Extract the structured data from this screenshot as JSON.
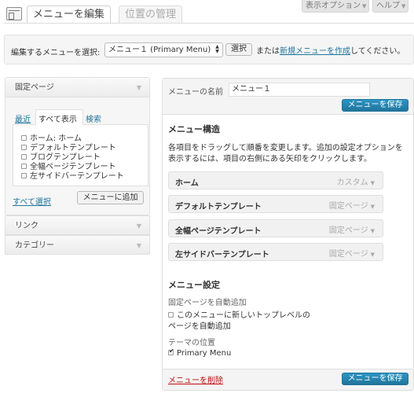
{
  "top_buttons": {
    "screen_options": "表示オプション",
    "help": "ヘルプ"
  },
  "header": {
    "active_tab": "メニューを編集",
    "inactive_tab": "位置の管理"
  },
  "select_bar": {
    "label": "編集するメニューを選択:",
    "selected_menu": "メニュー１ (Primary Menu)",
    "select_button": "選択",
    "or_text": "または",
    "create_link": "新規メニューを作成",
    "suffix": "してください。"
  },
  "sidebar": {
    "pages_title": "固定ページ",
    "tabs": [
      "最近",
      "すべて表示",
      "検索"
    ],
    "page_items": [
      "ホーム: ホーム",
      "デフォルトテンプレート",
      "ブログテンプレート",
      "全幅ページテンプレート",
      "左サイドバーテンプレート"
    ],
    "select_all": "すべて選択",
    "add_button": "メニューに追加",
    "links_title": "リンク",
    "categories_title": "カテゴリー"
  },
  "editor": {
    "name_label": "メニューの名前",
    "name_value": "メニュー１",
    "save_button": "メニューを保存",
    "structure_title": "メニュー構造",
    "structure_help_line1": "各項目をドラッグして順番を変更します。追加の設定オプションを",
    "structure_help_line2": "表示するには、項目の右側にある矢印をクリックします。",
    "items": [
      {
        "title": "ホーム",
        "type": "カスタム"
      },
      {
        "title": "デフォルトテンプレート",
        "type": "固定ページ"
      },
      {
        "title": "全幅ページテンプレート",
        "type": "固定ページ"
      },
      {
        "title": "左サイドバーテンプレート",
        "type": "固定ページ"
      }
    ],
    "settings_title": "メニュー設定",
    "auto_add_label": "固定ページを自動追加",
    "auto_add_option_line1": "このメニューに新しいトップレベルの",
    "auto_add_option_line2": "ページを自動追加",
    "auto_add_checked": false,
    "theme_location_label": "テーマの位置",
    "primary_menu_label": "Primary Menu",
    "primary_menu_checked": true,
    "delete_link": "メニューを削除",
    "save_button_bottom": "メニューを保存"
  }
}
